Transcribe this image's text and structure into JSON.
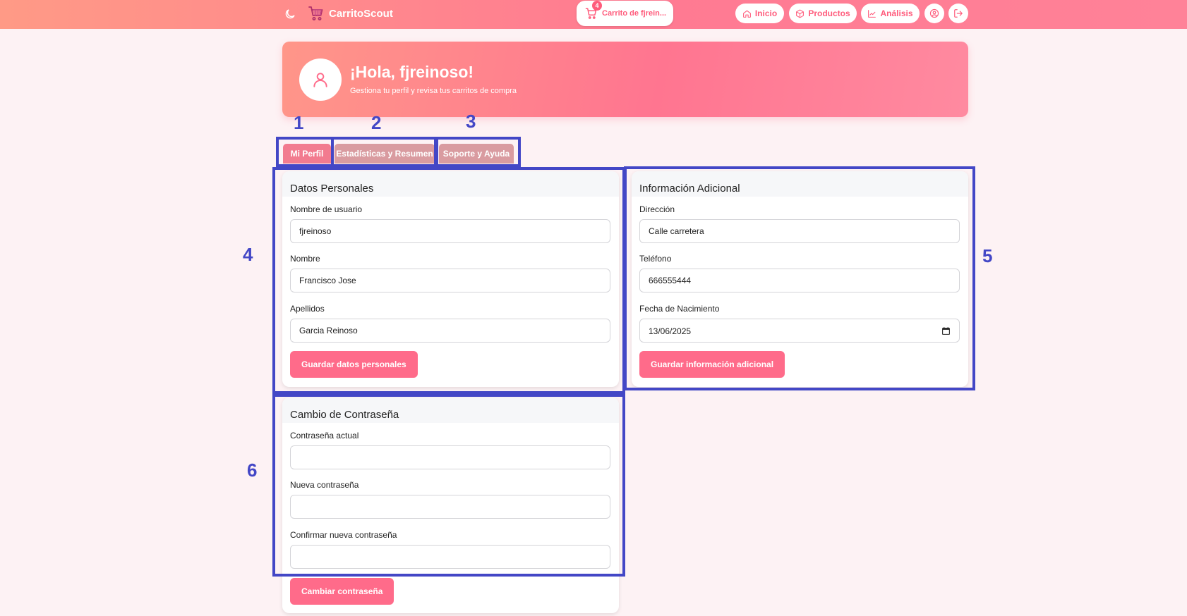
{
  "header": {
    "brand": "CarritoScout",
    "cart": {
      "count": "4",
      "label": "Carrito de fjrein..."
    },
    "nav": [
      {
        "label": "Inicio",
        "icon": "home-icon"
      },
      {
        "label": "Productos",
        "icon": "box-icon"
      },
      {
        "label": "Análisis",
        "icon": "chart-line-icon"
      }
    ],
    "icons": [
      "moon-icon",
      "cart-logo-icon",
      "user-circle-icon",
      "logout-icon"
    ]
  },
  "hero": {
    "title": "¡Hola, fjreinoso!",
    "subtitle": "Gestiona tu perfil y revisa tus carritos de compra"
  },
  "tabs": [
    {
      "label": "Mi Perfil",
      "active": true
    },
    {
      "label": "Estadísticas y Resumen",
      "active": false
    },
    {
      "label": "Soporte y Ayuda",
      "active": false
    }
  ],
  "personal": {
    "title": "Datos Personales",
    "username_label": "Nombre de usuario",
    "username_value": "fjreinoso",
    "name_label": "Nombre",
    "name_value": "Francisco Jose",
    "surname_label": "Apellidos",
    "surname_value": "Garcia Reinoso",
    "save_label": "Guardar datos personales"
  },
  "additional": {
    "title": "Información Adicional",
    "address_label": "Dirección",
    "address_value": "Calle carretera",
    "phone_label": "Teléfono",
    "phone_value": "666555444",
    "birth_label": "Fecha de Nacimiento",
    "birth_value": "13/06/2025",
    "save_label": "Guardar información adicional"
  },
  "password": {
    "title": "Cambio de Contraseña",
    "current_label": "Contraseña actual",
    "current_value": "",
    "new_label": "Nueva contraseña",
    "new_value": "",
    "confirm_label": "Confirmar nueva contraseña",
    "confirm_value": "",
    "submit_label": "Cambiar contraseña"
  },
  "annotations": [
    "1",
    "2",
    "3",
    "4",
    "5",
    "6"
  ],
  "colors": {
    "accent": "#ff6b8a",
    "header_start": "#ff9a86",
    "header_end": "#ff7a92",
    "annotation": "#4347c6",
    "tab_active": "#f27b8f",
    "tab_inactive": "#d99ba0",
    "page_bg": "#fdf2f4"
  }
}
